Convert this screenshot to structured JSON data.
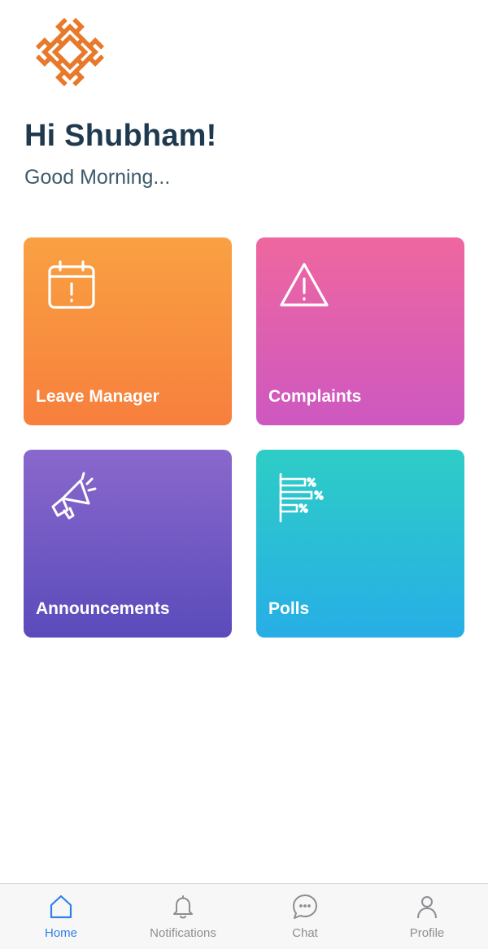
{
  "app": {
    "logo_icon": "endless-knot-logo-icon",
    "brand_color": "#e8792a"
  },
  "header": {
    "greeting": "Hi Shubham!",
    "subgreeting": "Good Morning..."
  },
  "tiles": [
    {
      "label": "Leave Manager",
      "icon": "calendar-alert-icon",
      "colors": [
        "#f9a142",
        "#f77f3d"
      ]
    },
    {
      "label": "Complaints",
      "icon": "warning-triangle-icon",
      "colors": [
        "#ef679f",
        "#cd58c0"
      ]
    },
    {
      "label": "Announcements",
      "icon": "megaphone-icon",
      "colors": [
        "#8a68cc",
        "#5a4bbb"
      ]
    },
    {
      "label": "Polls",
      "icon": "poll-bars-icon",
      "colors": [
        "#2ecdc6",
        "#27aee6"
      ]
    }
  ],
  "tabbar": {
    "active_color": "#2f80ed",
    "inactive_color": "#8e8e93",
    "items": [
      {
        "label": "Home",
        "icon": "home-icon",
        "active": true
      },
      {
        "label": "Notifications",
        "icon": "bell-icon",
        "active": false
      },
      {
        "label": "Chat",
        "icon": "chat-bubble-icon",
        "active": false
      },
      {
        "label": "Profile",
        "icon": "person-icon",
        "active": false
      }
    ]
  }
}
